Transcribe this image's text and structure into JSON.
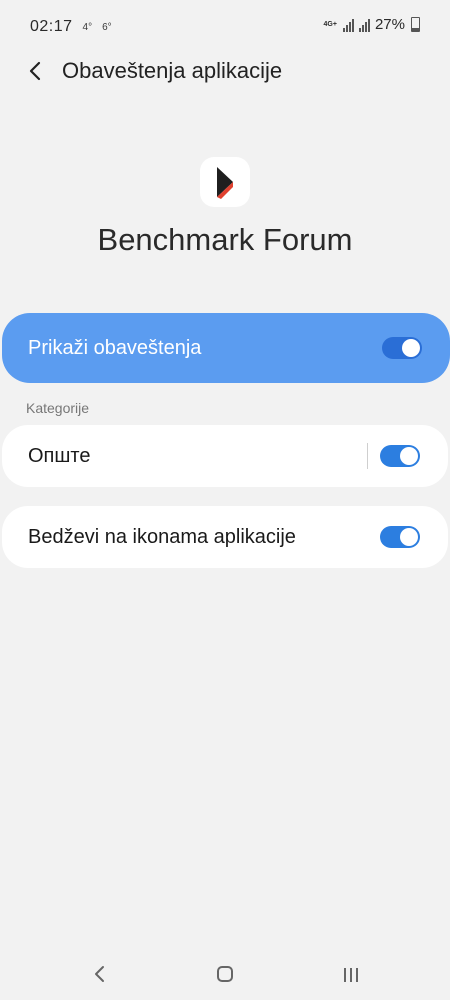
{
  "status_bar": {
    "time": "02:17",
    "indicator_1": "4°",
    "indicator_2": "6°",
    "network": "4G+",
    "battery": "27%"
  },
  "header": {
    "title": "Obaveštenja aplikacije",
    "back_icon": "chevron-left-icon"
  },
  "app": {
    "name": "Benchmark Forum",
    "icon": "benchmark-logo-icon"
  },
  "main_toggle": {
    "label": "Prikaži obaveštenja",
    "enabled": true
  },
  "categories": {
    "section_label": "Kategorije",
    "items": [
      {
        "label": "Опште",
        "enabled": true
      }
    ]
  },
  "badges": {
    "label": "Bedževi na ikonama aplikacije",
    "enabled": true
  },
  "nav": {
    "back_icon": "nav-back-icon",
    "home_icon": "nav-home-icon",
    "recents_icon": "nav-recents-icon"
  },
  "colors": {
    "background": "#f2f2f2",
    "main_toggle_bg": "#5b9cf0",
    "switch_on": "#2c7ee0",
    "card_bg": "#ffffff"
  }
}
